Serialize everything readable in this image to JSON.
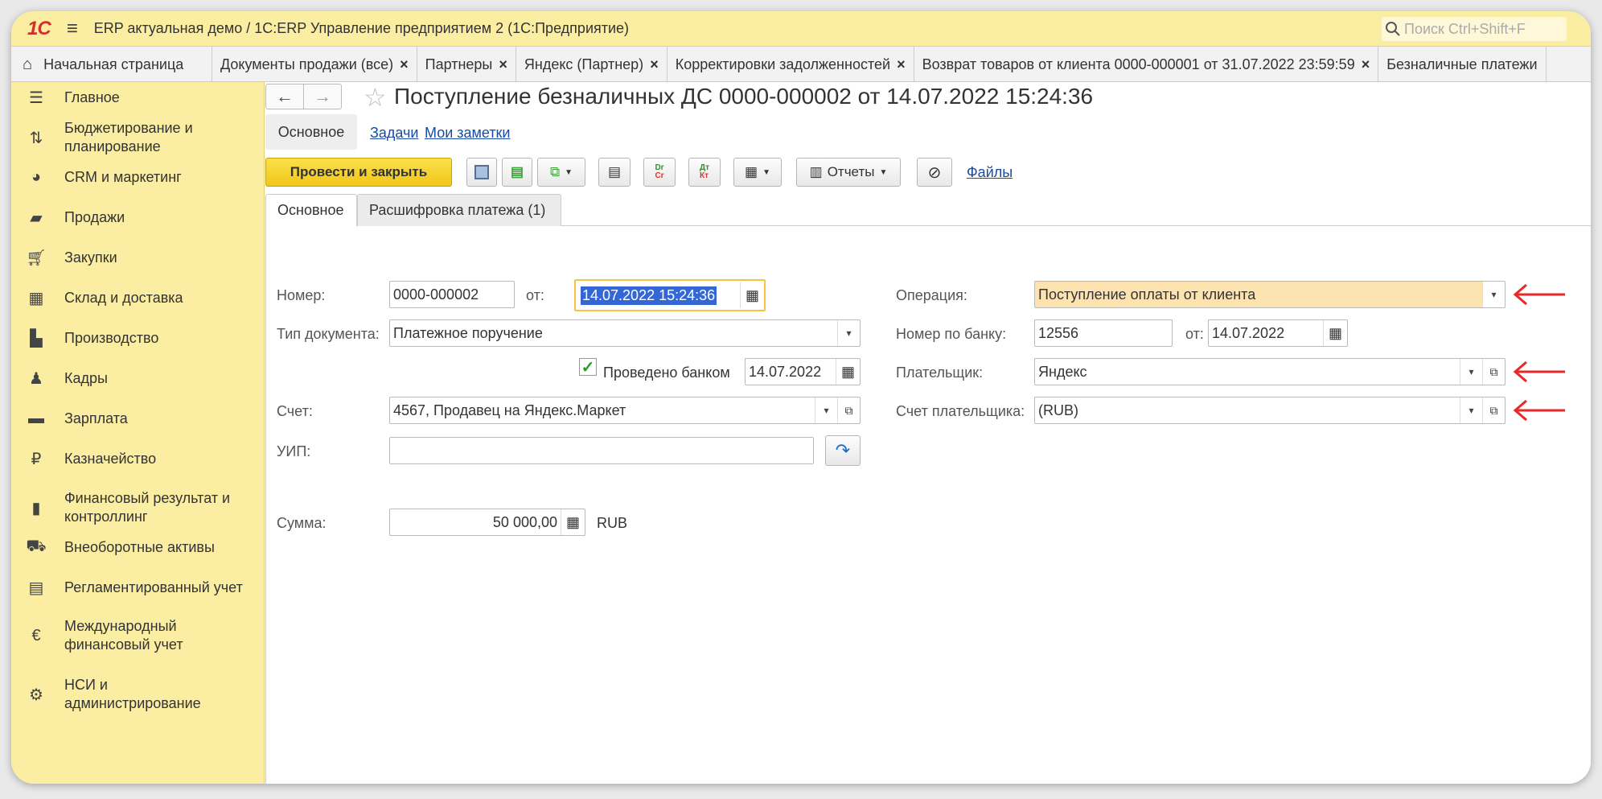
{
  "titlebar": {
    "logo": "1С",
    "app_title": "ERP актуальная демо / 1С:ERP Управление предприятием 2  (1С:Предприятие)",
    "search_placeholder": "Поиск Ctrl+Shift+F"
  },
  "tabs": [
    {
      "label": "Начальная страница"
    },
    {
      "label": "Документы продажи (все)"
    },
    {
      "label": "Партнеры"
    },
    {
      "label": "Яндекс (Партнер)"
    },
    {
      "label": "Корректировки задолженностей"
    },
    {
      "label": "Возврат товаров от клиента 0000-000001 от 31.07.2022 23:59:59"
    },
    {
      "label": "Безналичные платежи"
    }
  ],
  "sidebar": {
    "items": [
      {
        "label": "Главное",
        "icon": "menu-icon"
      },
      {
        "label": "Бюджетирование и планирование",
        "icon": "budget-icon"
      },
      {
        "label": "CRM и маркетинг",
        "icon": "crm-icon"
      },
      {
        "label": "Продажи",
        "icon": "bag-icon"
      },
      {
        "label": "Закупки",
        "icon": "cart-icon"
      },
      {
        "label": "Склад и доставка",
        "icon": "warehouse-icon"
      },
      {
        "label": "Производство",
        "icon": "factory-icon"
      },
      {
        "label": "Кадры",
        "icon": "person-icon"
      },
      {
        "label": "Зарплата",
        "icon": "wallet-icon"
      },
      {
        "label": "Казначейство",
        "icon": "ruble-icon"
      },
      {
        "label": "Финансовый результат и контроллинг",
        "icon": "chart-icon"
      },
      {
        "label": "Внеоборотные активы",
        "icon": "truck-icon"
      },
      {
        "label": "Регламентированный учет",
        "icon": "calculator-icon"
      },
      {
        "label": "Международный финансовый учет",
        "icon": "euro-icon"
      },
      {
        "label": "НСИ и администрирование",
        "icon": "gear-icon"
      }
    ]
  },
  "document": {
    "title": "Поступление безналичных ДС 0000-000002 от 14.07.2022 15:24:36",
    "nav": {
      "main": "Основное",
      "tasks": "Задачи",
      "notes": "Мои заметки"
    }
  },
  "toolbar": {
    "post_close": "Провести и закрыть",
    "reports": "Отчеты",
    "files": "Файлы"
  },
  "form_tabs": {
    "main": "Основное",
    "decoding": "Расшифровка платежа (1)"
  },
  "form": {
    "number_label": "Номер:",
    "number_value": "0000-000002",
    "from_label": "от:",
    "date_value": "14.07.2022 15:24:36",
    "operation_label": "Операция:",
    "operation_value": "Поступление оплаты от клиента",
    "doc_type_label": "Тип документа:",
    "doc_type_value": "Платежное поручение",
    "bank_number_label": "Номер по банку:",
    "bank_number_value": "12556",
    "bank_from_label": "от:",
    "bank_date_value": "14.07.2022",
    "posted_by_bank_label": "Проведено банком",
    "posted_by_bank_date": "14.07.2022",
    "payer_label": "Плательщик:",
    "payer_value": "Яндекс",
    "account_label": "Счет:",
    "account_value": "4567, Продавец на Яндекс.Маркет",
    "payer_account_label": "Счет плательщика:",
    "payer_account_value": "(RUB)",
    "uip_label": "УИП:",
    "uip_value": "",
    "amount_label": "Сумма:",
    "amount_value": "50 000,00",
    "currency": "RUB"
  },
  "colors": {
    "accent": "#fbeda1",
    "primary_button": "#f5cc25",
    "annotation_arrow": "#e8282b"
  }
}
